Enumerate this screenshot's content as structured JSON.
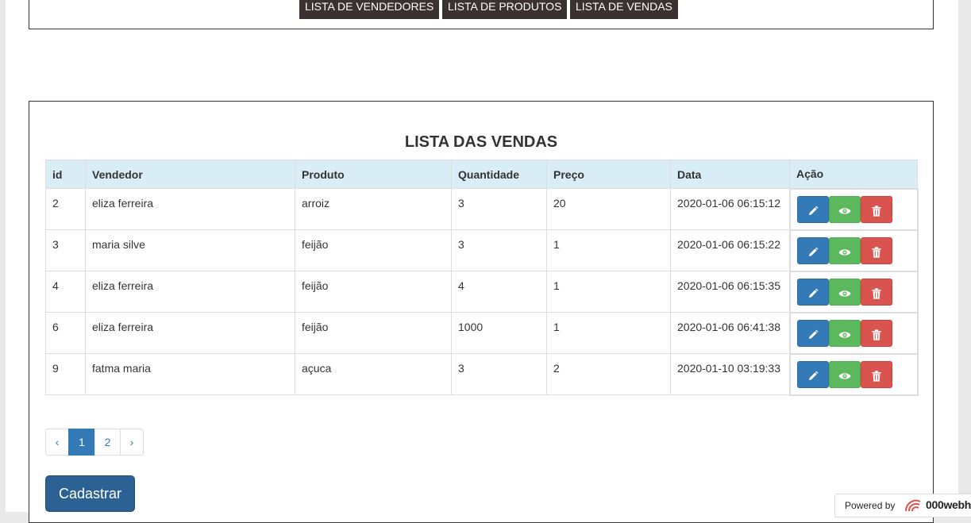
{
  "nav": {
    "vendedores": "LISTA DE VENDEDORES",
    "produtos": "LISTA DE PRODUTOS",
    "vendas": "LISTA DE VENDAS"
  },
  "page_title": "LISTA DAS VENDAS",
  "table": {
    "headers": [
      "id",
      "Vendedor",
      "Produto",
      "Quantidade",
      "Preço",
      "Data",
      "Ação"
    ],
    "rows": [
      [
        "2",
        "eliza ferreira",
        "arroiz",
        "3",
        "20",
        "2020-01-06 06:15:12"
      ],
      [
        "3",
        "maria silve",
        "feijão",
        "3",
        "1",
        "2020-01-06 06:15:22"
      ],
      [
        "4",
        "eliza ferreira",
        "feijão",
        "4",
        "1",
        "2020-01-06 06:15:35"
      ],
      [
        "6",
        "eliza ferreira",
        "feijão",
        "1000",
        "1",
        "2020-01-06 06:41:38"
      ],
      [
        "9",
        "fatma maria",
        "açuca",
        "3",
        "2",
        "2020-01-10 03:19:33"
      ]
    ],
    "row_actions": [
      "pencil-icon",
      "eye-icon",
      "trash-icon"
    ]
  },
  "pagination": {
    "prev": "‹",
    "pages": [
      "1",
      "2"
    ],
    "current": "1",
    "next": "›"
  },
  "cadastrar_label": "Cadastrar",
  "powered": {
    "text": "Powered by",
    "brand": "000webh"
  },
  "colors": {
    "nav_bg": "#3a3231",
    "header_bg": "#d9edf7",
    "edit": "#337ab7",
    "view": "#5cb85c",
    "delete": "#d9534f",
    "primary": "#2b6193"
  }
}
